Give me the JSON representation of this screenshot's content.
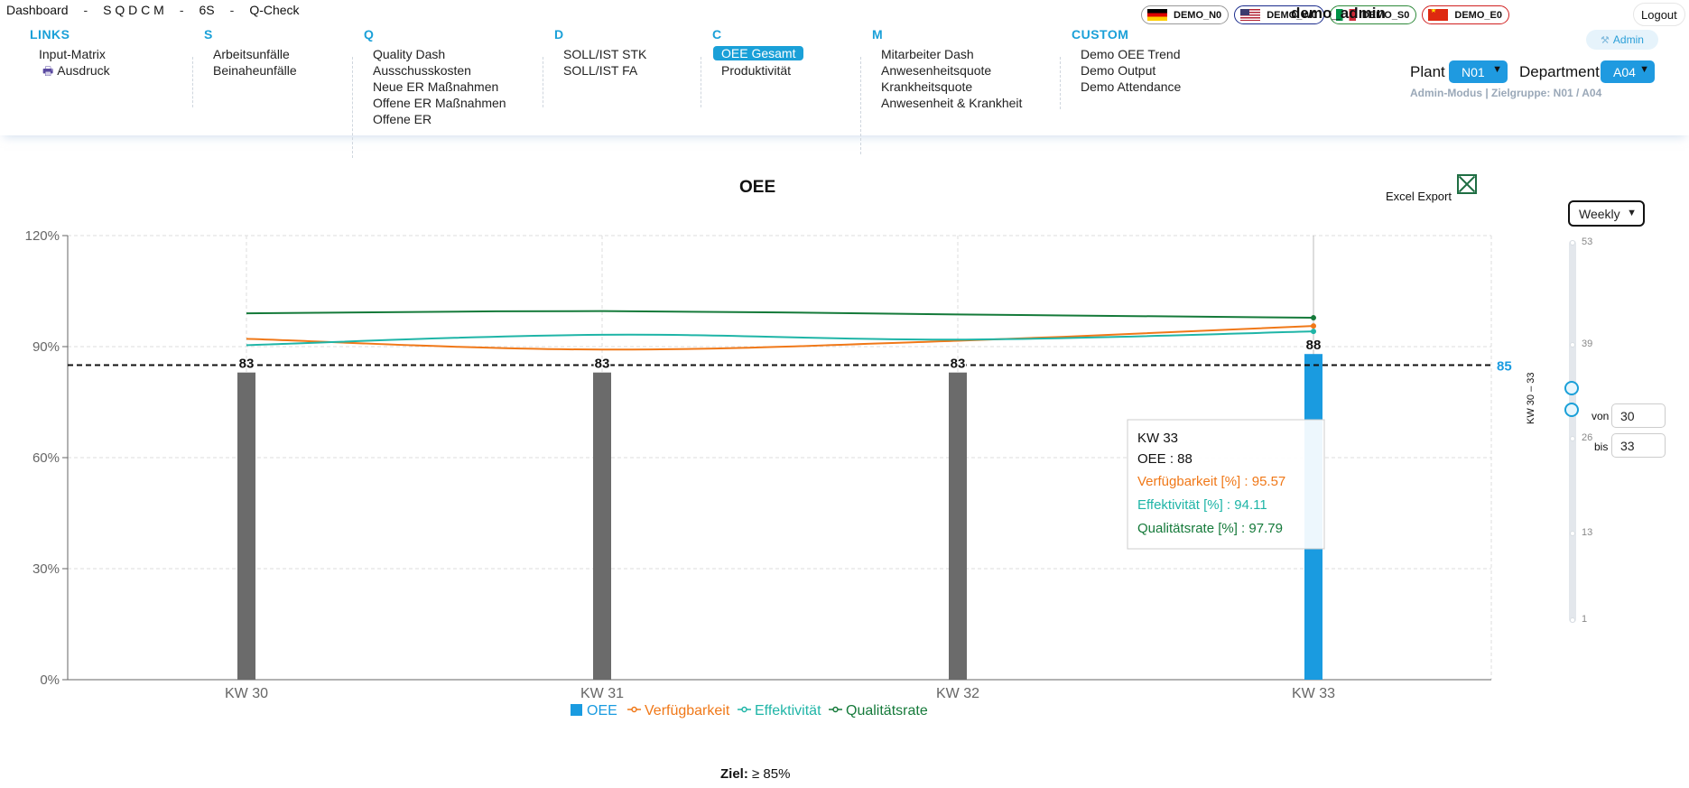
{
  "topnav": {
    "dashboard": "Dashboard",
    "sqdcm": "S Q D C M",
    "six_s": "6S",
    "qcheck": "Q-Check",
    "separator": "-"
  },
  "menu": [
    {
      "category": "LINKS",
      "items": [
        "Input-Matrix",
        "Ausdruck"
      ]
    },
    {
      "category": "S",
      "items": [
        "Arbeitsunfälle",
        "Beinaheunfälle"
      ]
    },
    {
      "category": "Q",
      "items": [
        "Quality Dash",
        "Ausschusskosten",
        "Neue ER Maßnahmen",
        "Offene ER Maßnahmen",
        "Offene ER"
      ]
    },
    {
      "category": "D",
      "items": [
        "SOLL/IST STK",
        "SOLL/IST FA"
      ]
    },
    {
      "category": "C",
      "items": [
        "OEE Gesamt",
        "Produktivität"
      ]
    },
    {
      "category": "M",
      "items": [
        "Mitarbeiter Dash",
        "Anwesenheitsquote",
        "Krankheitsquote",
        "Anwesenheit & Krankheit"
      ]
    },
    {
      "category": "CUSTOM",
      "items": [
        "Demo OEE Trend",
        "Demo Output",
        "Demo Attendance"
      ]
    }
  ],
  "active_menu_item": "OEE Gesamt",
  "print_icon": "printer-icon",
  "flags": [
    {
      "label": "DEMO_N0",
      "icon": "flag-de-icon"
    },
    {
      "label": "DEMO_W0",
      "icon": "flag-us-icon"
    },
    {
      "label": "DEMO_S0",
      "icon": "flag-it-icon"
    },
    {
      "label": "DEMO_E0",
      "icon": "flag-cn-icon"
    }
  ],
  "user": {
    "name": "demo_admin",
    "logout": "Logout",
    "admin_badge": "Admin",
    "admin_icon": "wrench-icon"
  },
  "filters": {
    "plant_label": "Plant",
    "plant_value": "N01",
    "department_label": "Department",
    "department_value": "A04",
    "admin_mode": "Admin-Modus | Zielgruppe: N01 / A04"
  },
  "excel_export": {
    "label": "Excel Export",
    "icon": "excel-icon"
  },
  "period": {
    "value": "Weekly"
  },
  "range": {
    "ticks": [
      "53",
      "39",
      "26",
      "13",
      "1"
    ],
    "tick_values": [
      53,
      39,
      26,
      13,
      1
    ],
    "from": 30,
    "to": 33,
    "vertical_label": "KW 30 – 33",
    "from_label": "von",
    "to_label": "bis",
    "from_value": "30",
    "to_value": "33"
  },
  "goal": {
    "label": "Ziel:",
    "value": "≥ 85%"
  },
  "colors": {
    "oee_bar": "#6b6b6b",
    "oee_bar_selected": "#1a9be0",
    "verfuegbarkeit": "#f07818",
    "effektivitaet": "#1fb5a7",
    "qualitaetsrate": "#157a3a",
    "accent": "#1aa0d8"
  },
  "chart_data": {
    "type": "bar",
    "title": "OEE",
    "categories": [
      "KW 30",
      "KW 31",
      "KW 32",
      "KW 33"
    ],
    "ylim": [
      0,
      120
    ],
    "yticks": [
      "0%",
      "30%",
      "60%",
      "90%",
      "120%"
    ],
    "ytick_values": [
      0,
      30,
      60,
      90,
      120
    ],
    "grid": true,
    "legend_position": "bottom",
    "target": {
      "value": 85,
      "label": "85"
    },
    "selected_index": 3,
    "series": [
      {
        "name": "OEE",
        "type": "bar",
        "values": [
          83,
          83,
          83,
          88
        ],
        "labels": [
          "83",
          "83",
          "83",
          "88"
        ]
      },
      {
        "name": "Verfügbarkeit",
        "type": "line",
        "values": [
          92.1,
          89.2,
          91.6,
          95.57
        ]
      },
      {
        "name": "Effektivität",
        "type": "line",
        "values": [
          90.4,
          93.2,
          91.9,
          94.11
        ]
      },
      {
        "name": "Qualitätsrate",
        "type": "line",
        "values": [
          99.0,
          99.6,
          98.7,
          97.79
        ]
      }
    ],
    "tooltip": {
      "title": "KW 33",
      "rows": [
        "OEE : 88",
        "Verfügbarkeit [%] : 95.57",
        "Effektivität [%] : 94.11",
        "Qualitätsrate [%] : 97.79"
      ]
    }
  }
}
